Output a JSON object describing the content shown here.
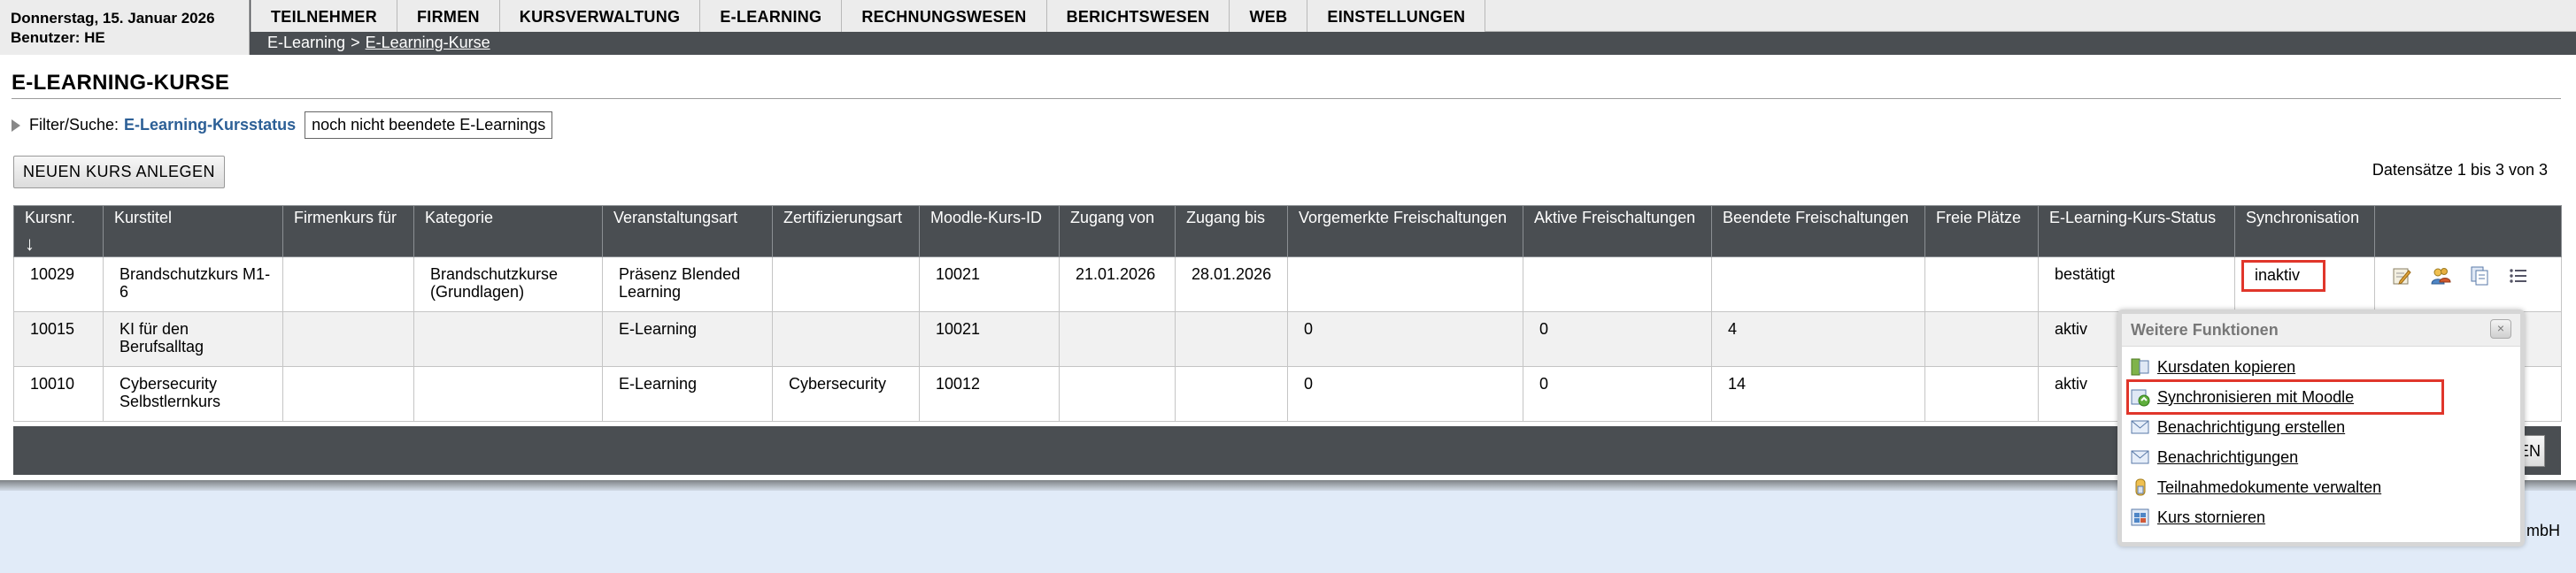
{
  "header": {
    "date": "Donnerstag, 15. Januar 2026",
    "user": "Benutzer: HE",
    "nav": [
      "TEILNEHMER",
      "FIRMEN",
      "KURSVERWALTUNG",
      "E-LEARNING",
      "RECHNUNGSWESEN",
      "BERICHTSWESEN",
      "WEB",
      "EINSTELLUNGEN"
    ],
    "breadcrumb": {
      "parent": "E-Learning",
      "separator": ">",
      "current": "E-Learning-Kurse"
    }
  },
  "page": {
    "title": "E-LEARNING-KURSE",
    "filter_label": "Filter/Suche:",
    "filter_key": "E-Learning-Kursstatus",
    "filter_value": "noch nicht beendete E-Learnings",
    "new_button": "NEUEN KURS ANLEGEN",
    "records": "Datensätze 1 bis 3 von 3"
  },
  "table": {
    "columns": [
      "Kursnr.",
      "Kurstitel",
      "Firmenkurs für",
      "Kategorie",
      "Veranstaltungsart",
      "Zertifizierungsart",
      "Moodle-Kurs-ID",
      "Zugang von",
      "Zugang bis",
      "Vorgemerkte Freischaltungen",
      "Aktive Freischaltungen",
      "Beendete Freischaltungen",
      "Freie Plätze",
      "E-Learning-Kurs-Status",
      "Synchronisation",
      ""
    ],
    "sort_indicator": "↓",
    "rows": [
      [
        "10029",
        "Brandschutzkurs M1-6",
        "",
        "Brandschutzkurse (Grundlagen)",
        "Präsenz Blended Learning",
        "",
        "10021",
        "21.01.2026",
        "28.01.2026",
        "",
        "",
        "",
        "",
        "bestätigt",
        "inaktiv"
      ],
      [
        "10015",
        "KI für den Berufsalltag",
        "",
        "",
        "E-Learning",
        "",
        "10021",
        "",
        "",
        "0",
        "0",
        "4",
        "",
        "aktiv",
        ""
      ],
      [
        "10010",
        "Cybersecurity Selbstlernkurs",
        "",
        "",
        "E-Learning",
        "Cybersecurity",
        "10012",
        "",
        "",
        "0",
        "0",
        "14",
        "",
        "aktiv",
        ""
      ]
    ],
    "row_action_icons": [
      "edit-icon",
      "users-icon",
      "copy-icon",
      "list-icon"
    ],
    "footer_button_partial": "EN"
  },
  "popup": {
    "title": "Weitere Funktionen",
    "close": "×",
    "items": [
      {
        "label": "Kursdaten kopieren",
        "icon": "copy-data-icon"
      },
      {
        "label": "Synchronisieren mit Moodle",
        "icon": "sync-icon"
      },
      {
        "label": "Benachrichtigung erstellen",
        "icon": "mail-create-icon"
      },
      {
        "label": "Benachrichtigungen",
        "icon": "mail-icon"
      },
      {
        "label": "Teilnahmedokumente verwalten",
        "icon": "documents-icon"
      },
      {
        "label": "Kurs stornieren",
        "icon": "cancel-course-icon"
      }
    ]
  },
  "footer": {
    "copyright_partial": "mbH"
  },
  "colors": {
    "header_bg": "#4a4e52",
    "link_blue": "#2c5f96",
    "highlight_red": "#e0362b",
    "footer_band": "#e1ebf8"
  }
}
